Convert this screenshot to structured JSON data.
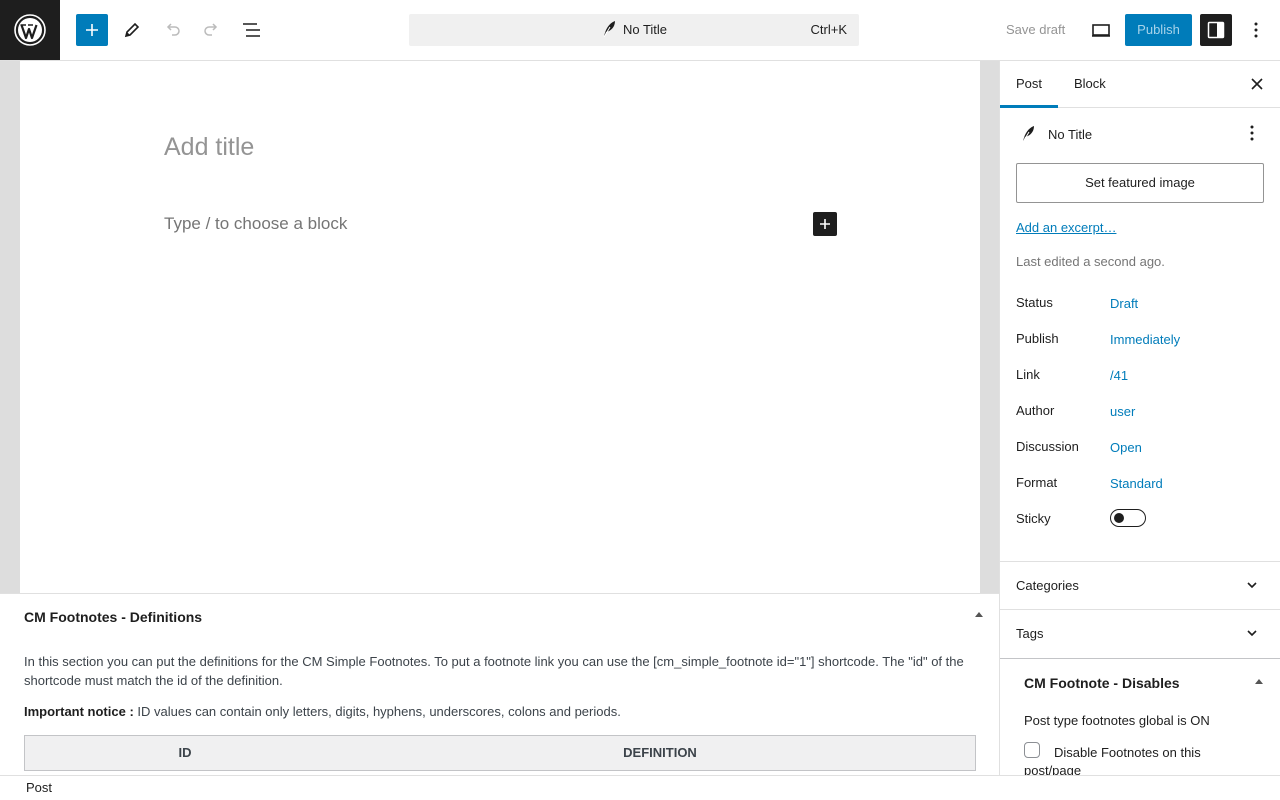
{
  "topbar": {
    "command_title": "No Title",
    "command_shortcut": "Ctrl+K",
    "save_draft": "Save draft",
    "publish": "Publish"
  },
  "canvas": {
    "title_placeholder": "Add title",
    "block_placeholder": "Type / to choose a block"
  },
  "metabox": {
    "title": "CM Footnotes - Definitions",
    "description": "In this section you can put the definitions for the CM Simple Footnotes. To put a footnote link you can use the [cm_simple_footnote id=\"1\"] shortcode. The \"id\" of the shortcode must match the id of the definition.",
    "notice_label": "Important notice :",
    "notice_text": " ID values can contain only letters, digits, hyphens, underscores, colons and periods.",
    "columns": [
      "ID",
      "DEFINITION"
    ]
  },
  "statusbar": {
    "label": "Post"
  },
  "sidebar": {
    "tabs": [
      "Post",
      "Block"
    ],
    "post_title": "No Title",
    "featured_image": "Set featured image",
    "excerpt": "Add an excerpt…",
    "last_edited": "Last edited a second ago.",
    "rows": [
      {
        "label": "Status",
        "value": "Draft"
      },
      {
        "label": "Publish",
        "value": "Immediately"
      },
      {
        "label": "Link",
        "value": "/41"
      },
      {
        "label": "Author",
        "value": "user"
      },
      {
        "label": "Discussion",
        "value": "Open"
      },
      {
        "label": "Format",
        "value": "Standard"
      }
    ],
    "sticky_label": "Sticky",
    "sticky_on": false,
    "panels": [
      "Categories",
      "Tags"
    ],
    "cm_box": {
      "title": "CM Footnote - Disables",
      "global": "Post type footnotes global is ON",
      "checkbox_label": "Disable Footnotes on this post/page",
      "checked": false
    }
  }
}
